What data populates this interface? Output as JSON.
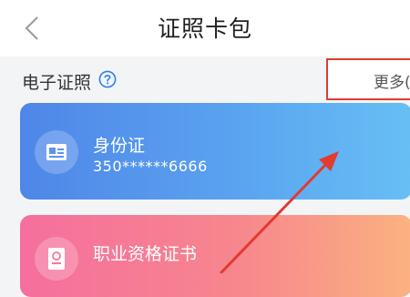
{
  "header": {
    "title": "证照卡包",
    "back_icon": "chevron-left-icon"
  },
  "section": {
    "title": "电子证照",
    "help_icon": "question-circle-icon",
    "more_label": "更多("
  },
  "cards": [
    {
      "title": "身份证",
      "number": "350******6666",
      "icon": "id-card-icon"
    },
    {
      "title": "职业资格证书",
      "icon": "certificate-icon"
    }
  ],
  "colors": {
    "id_card_gradient": [
      "#4f86e8",
      "#67bff4"
    ],
    "cert_card_gradient": [
      "#f56f9e",
      "#fbb281"
    ],
    "annotation_red": "#e23b2f"
  }
}
